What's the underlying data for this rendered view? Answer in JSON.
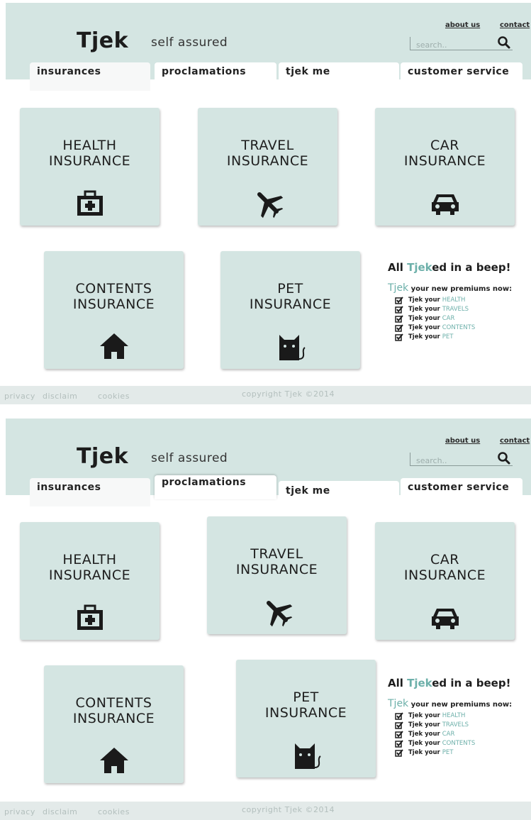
{
  "header": {
    "logo": "Tjek",
    "tagline": "self assured",
    "links": {
      "about": "about us",
      "contact": "contact"
    },
    "search_placeholder": "search.."
  },
  "nav": {
    "insurances": "insurances",
    "proclamations": "proclamations",
    "tjek_me": "tjek me",
    "customer_service": "customer service"
  },
  "cards": {
    "health": {
      "line1": "HEALTH",
      "line2": "INSURANCE"
    },
    "travel": {
      "line1": "TRAVEL",
      "line2": "INSURANCE"
    },
    "car": {
      "line1": "CAR",
      "line2": "INSURANCE"
    },
    "contents": {
      "line1": "CONTENTS",
      "line2": "INSURANCE"
    },
    "pet": {
      "line1": "PET",
      "line2": "INSURANCE"
    }
  },
  "promo": {
    "title_pre": "All ",
    "title_brand": "Tjek",
    "title_post": "ed in a beep!",
    "sub_brand": "Tjek",
    "sub_text": " your new premiums now:",
    "item_prefix": "Tjek your",
    "items": [
      "HEALTH",
      "TRAVELS",
      "CAR",
      "CONTENTS",
      "PET"
    ]
  },
  "footer": {
    "privacy": "privacy",
    "disclaim": "disclaim",
    "cookies": "cookies",
    "copyright": "copyright Tjek ©2014"
  },
  "colors": {
    "panel": "#d4e5e2",
    "accent": "#6db0aa",
    "footer": "#e3eae9"
  },
  "icons": [
    "search-icon",
    "medical-kit-icon",
    "airplane-icon",
    "car-icon",
    "house-icon",
    "cat-icon",
    "checkbox-icon"
  ]
}
